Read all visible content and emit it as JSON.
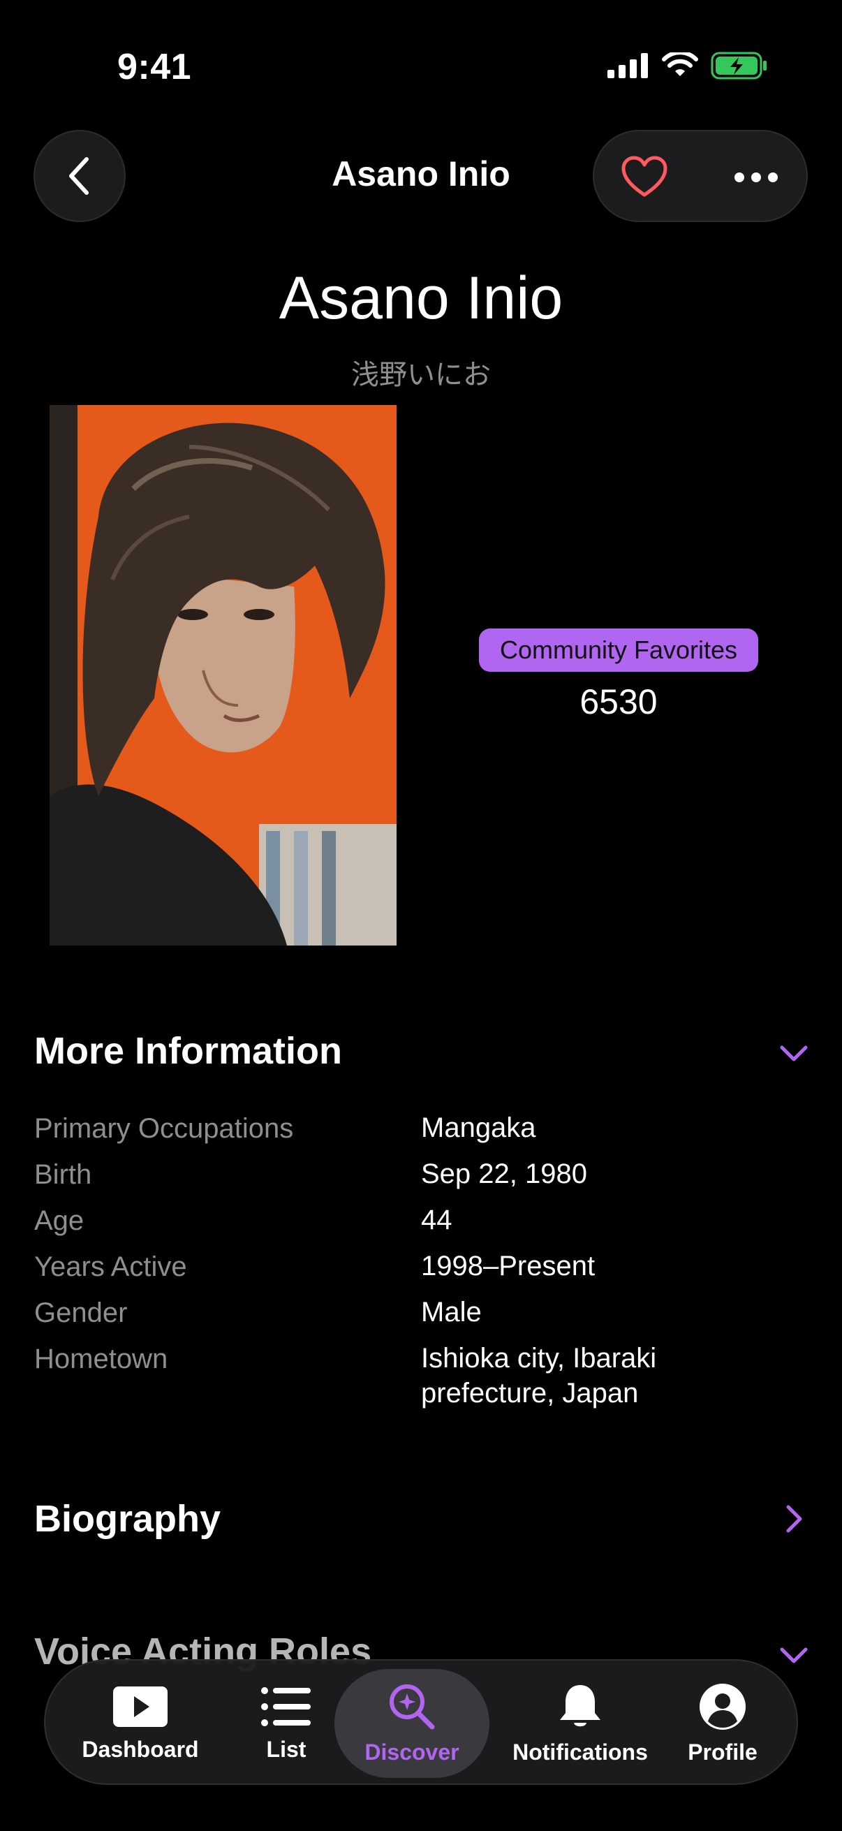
{
  "status": {
    "time": "9:41"
  },
  "nav": {
    "title": "Asano Inio"
  },
  "person": {
    "name": "Asano Inio",
    "native_name": "浅野いにお",
    "favorites_label": "Community Favorites",
    "favorites_count": "6530"
  },
  "more_info": {
    "title": "More Information",
    "rows": [
      {
        "label": "Primary Occupations",
        "value": "Mangaka"
      },
      {
        "label": "Birth",
        "value": "Sep 22, 1980"
      },
      {
        "label": "Age",
        "value": "44"
      },
      {
        "label": "Years Active",
        "value": "1998–Present"
      },
      {
        "label": "Gender",
        "value": "Male"
      },
      {
        "label": "Hometown",
        "value": "Ishioka city, Ibaraki prefecture, Japan"
      }
    ]
  },
  "biography": {
    "title": "Biography"
  },
  "voice_roles": {
    "title": "Voice Acting Roles"
  },
  "tabs": [
    {
      "label": "Dashboard",
      "icon": "play-icon"
    },
    {
      "label": "List",
      "icon": "list-icon"
    },
    {
      "label": "Discover",
      "icon": "discover-search-icon",
      "active": true
    },
    {
      "label": "Notifications",
      "icon": "bell-icon"
    },
    {
      "label": "Profile",
      "icon": "profile-icon"
    }
  ],
  "colors": {
    "accent": "#b066f0",
    "favorite": "#ff5a5f",
    "battery": "#34c759"
  }
}
